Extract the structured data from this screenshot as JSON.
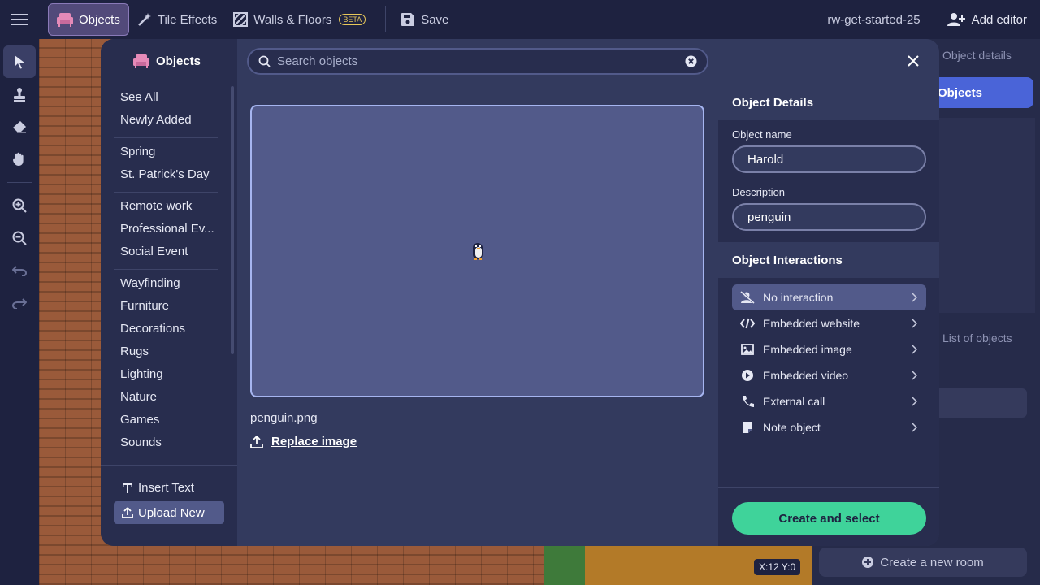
{
  "topbar": {
    "objects_label": "Objects",
    "tile_effects_label": "Tile Effects",
    "walls_floors_label": "Walls & Floors",
    "beta_label": "BETA",
    "save_label": "Save",
    "room_name": "rw-get-started-25",
    "add_editor_label": "Add editor"
  },
  "right_panel": {
    "object_details_tab": "Object details",
    "objects_button": "Objects",
    "list_tab": "List of objects",
    "create_room_label": "Create a new room"
  },
  "map": {
    "coordinates": "X:12  Y:0"
  },
  "modal": {
    "title": "Objects",
    "search": {
      "placeholder": "Search objects",
      "value": ""
    },
    "categories_group1": [
      "See All",
      "Newly Added"
    ],
    "categories_group2": [
      "Spring",
      "St. Patrick's Day"
    ],
    "categories_group3": [
      "Remote work",
      "Professional Ev...",
      "Social Event"
    ],
    "categories_group4": [
      "Wayfinding",
      "Furniture",
      "Decorations",
      "Rugs",
      "Lighting",
      "Nature",
      "Games",
      "Sounds"
    ],
    "insert_text_label": "Insert Text",
    "upload_new_label": "Upload New",
    "filename": "penguin.png",
    "replace_image_label": "Replace image",
    "details": {
      "header": "Object Details",
      "name_label": "Object name",
      "name_value": "Harold",
      "description_label": "Description",
      "description_value": "penguin",
      "interactions_header": "Object Interactions",
      "interactions": [
        {
          "label": "No interaction",
          "icon": "no-interaction-icon"
        },
        {
          "label": "Embedded website",
          "icon": "code-icon"
        },
        {
          "label": "Embedded image",
          "icon": "image-icon"
        },
        {
          "label": "Embedded video",
          "icon": "play-icon"
        },
        {
          "label": "External call",
          "icon": "phone-icon"
        },
        {
          "label": "Note object",
          "icon": "note-icon"
        }
      ],
      "create_button": "Create and select"
    }
  }
}
